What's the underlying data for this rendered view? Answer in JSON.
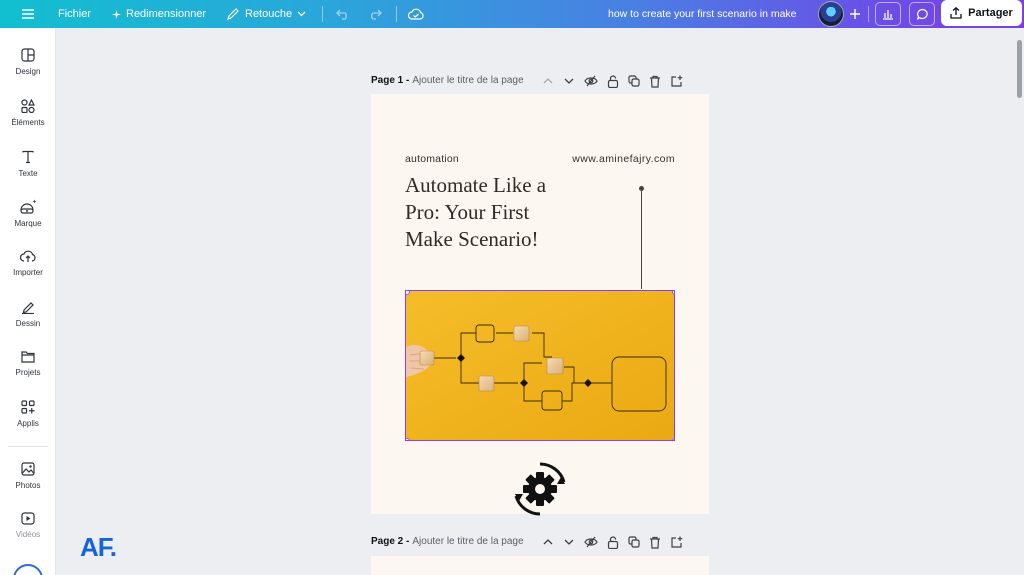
{
  "topbar": {
    "menu_label": "Fichier",
    "resize_label": "Redimensionner",
    "retouch_label": "Retouche",
    "doc_title": "how to create your first scenario in make",
    "share_label": "Partager"
  },
  "rail": {
    "items": [
      {
        "label": "Design",
        "icon": "layout-icon"
      },
      {
        "label": "Éléments",
        "icon": "shapes-icon"
      },
      {
        "label": "Texte",
        "icon": "text-icon"
      },
      {
        "label": "Marque",
        "icon": "brand-icon"
      },
      {
        "label": "Importer",
        "icon": "cloud-upload-icon"
      },
      {
        "label": "Dessin",
        "icon": "pen-icon"
      },
      {
        "label": "Projets",
        "icon": "folder-icon"
      },
      {
        "label": "Applis",
        "icon": "apps-icon"
      },
      {
        "label": "Photos",
        "icon": "image-icon"
      },
      {
        "label": "Vidéos",
        "icon": "video-icon"
      }
    ]
  },
  "pages": [
    {
      "label": "Page 1 -",
      "title_placeholder": "Ajouter le titre de la page"
    },
    {
      "label": "Page 2 -",
      "title_placeholder": "Ajouter le titre de la page"
    }
  ],
  "design": {
    "tag": "automation",
    "url": "www.aminefajry.com",
    "title_line1": "Automate Like a",
    "title_line2": "Pro: Your First",
    "title_line3": "Make Scenario!"
  },
  "logo": "AF.",
  "colors": {
    "accent": "#8b3dff",
    "image_bg": "#f2b51e",
    "page_bg": "#fdf7f1",
    "logo": "#1665d8"
  }
}
